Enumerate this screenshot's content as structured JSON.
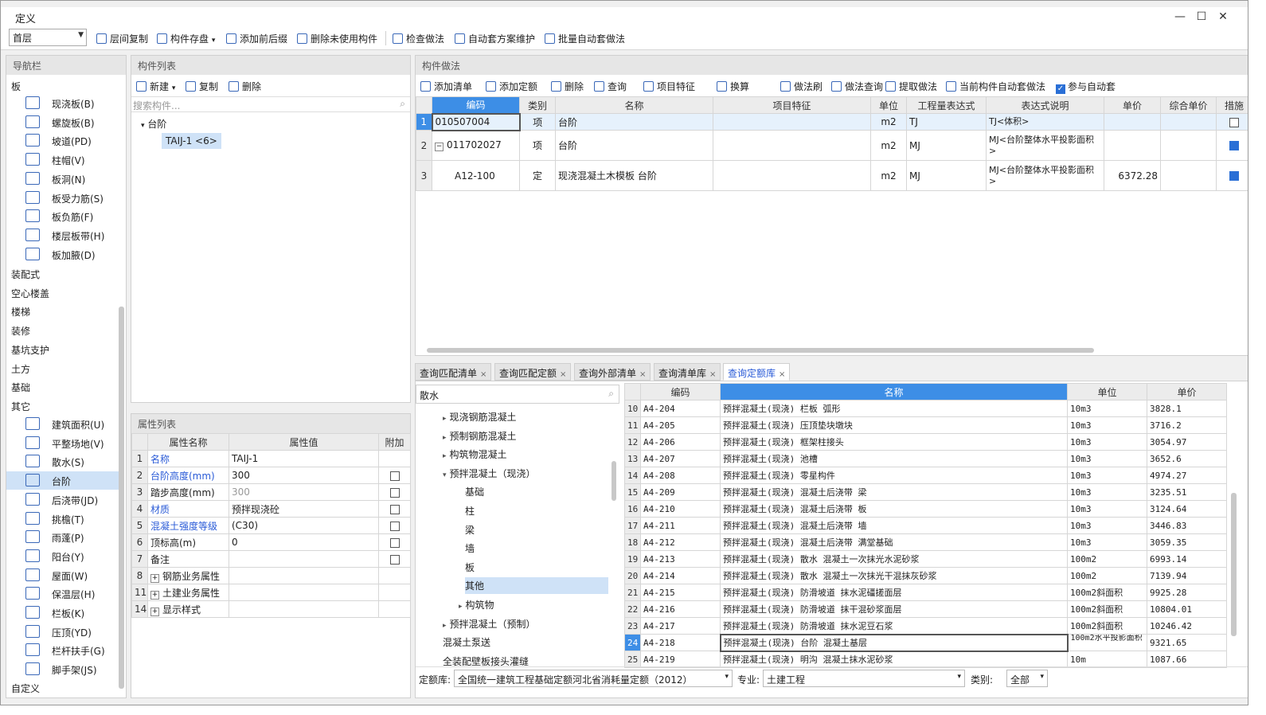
{
  "window": {
    "title": "定义"
  },
  "toolbar": {
    "floor_select": "首层",
    "items": [
      "层间复制",
      "构件存盘",
      "添加前后缀",
      "删除未使用构件",
      "检查做法",
      "自动套方案维护",
      "批量自动套做法"
    ]
  },
  "nav": {
    "header": "导航栏",
    "categories_top": [
      "板"
    ],
    "board_items": [
      "现浇板(B)",
      "螺旋板(B)",
      "坡道(PD)",
      "柱帽(V)",
      "板洞(N)",
      "板受力筋(S)",
      "板负筋(F)",
      "楼层板带(H)",
      "板加腋(D)"
    ],
    "categories_mid": [
      "装配式",
      "空心楼盖",
      "楼梯",
      "装修",
      "基坑支护",
      "土方",
      "基础",
      "其它"
    ],
    "other_items": [
      "建筑面积(U)",
      "平整场地(V)",
      "散水(S)",
      "台阶",
      "后浇带(JD)",
      "挑檐(T)",
      "雨蓬(P)",
      "阳台(Y)",
      "屋面(W)",
      "保温层(H)",
      "栏板(K)",
      "压顶(YD)",
      "栏杆扶手(G)",
      "脚手架(JS)"
    ],
    "selected": "台阶",
    "category_bottom": "自定义"
  },
  "component_list": {
    "header": "构件列表",
    "new_label": "新建",
    "copy_label": "复制",
    "delete_label": "删除",
    "search_placeholder": "搜索构件...",
    "tree_parent": "台阶",
    "tree_child": "TAIJ-1 <6>"
  },
  "properties": {
    "header": "属性列表",
    "columns": [
      "属性名称",
      "属性值",
      "附加"
    ],
    "rows": [
      {
        "n": "1",
        "name": "名称",
        "value": "TAIJ-1",
        "blue": true,
        "cb": false
      },
      {
        "n": "2",
        "name": "台阶高度(mm)",
        "value": "300",
        "blue": true,
        "cb": true
      },
      {
        "n": "3",
        "name": "踏步高度(mm)",
        "value": "300",
        "blue": false,
        "cb": true,
        "gray": true
      },
      {
        "n": "4",
        "name": "材质",
        "value": "预拌现浇砼",
        "blue": true,
        "cb": true
      },
      {
        "n": "5",
        "name": "混凝土强度等级",
        "value": "(C30)",
        "blue": true,
        "cb": true
      },
      {
        "n": "6",
        "name": "顶标高(m)",
        "value": "0",
        "blue": false,
        "cb": true
      },
      {
        "n": "7",
        "name": "备注",
        "value": "",
        "blue": false,
        "cb": true
      },
      {
        "n": "8",
        "name": "钢筋业务属性",
        "value": "",
        "expand": true
      },
      {
        "n": "11",
        "name": "土建业务属性",
        "value": "",
        "expand": true
      },
      {
        "n": "14",
        "name": "显示样式",
        "value": "",
        "expand": true
      }
    ]
  },
  "method": {
    "header": "构件做法",
    "toolbar": [
      "添加清单",
      "添加定额",
      "删除",
      "查询",
      "项目特征",
      "换算",
      "做法刷",
      "做法查询",
      "提取做法",
      "当前构件自动套做法",
      "参与自动套"
    ],
    "columns": [
      "编码",
      "类别",
      "名称",
      "项目特征",
      "单位",
      "工程量表达式",
      "表达式说明",
      "单价",
      "综合单价",
      "措施"
    ],
    "rows": [
      {
        "n": "1",
        "code": "010507004",
        "type": "项",
        "name": "台阶",
        "feature": "",
        "unit": "m2",
        "expr": "TJ",
        "desc": "TJ<体积>",
        "price": "",
        "cprice": ""
      },
      {
        "n": "2",
        "code": "011702027",
        "type": "项",
        "name": "台阶",
        "feature": "",
        "unit": "m2",
        "expr": "MJ",
        "desc": "MJ<台阶整体水平投影面积>",
        "price": "",
        "cprice": ""
      },
      {
        "n": "3",
        "code": "A12-100",
        "type": "定",
        "name": "现浇混凝土木模板 台阶",
        "feature": "",
        "unit": "m2",
        "expr": "MJ",
        "desc": "MJ<台阶整体水平投影面积>",
        "price": "6372.28",
        "cprice": ""
      }
    ]
  },
  "query_tabs": [
    "查询匹配清单",
    "查询匹配定额",
    "查询外部清单",
    "查询清单库",
    "查询定额库"
  ],
  "query": {
    "search_value": "散水",
    "tree": [
      {
        "label": "现浇钢筋混凝土",
        "level": 1,
        "arrow": "▸"
      },
      {
        "label": "预制钢筋混凝土",
        "level": 1,
        "arrow": "▸"
      },
      {
        "label": "构筑物混凝土",
        "level": 1,
        "arrow": "▸"
      },
      {
        "label": "预拌混凝土（现浇）",
        "level": 1,
        "arrow": "▾"
      },
      {
        "label": "基础",
        "level": 2,
        "arrow": ""
      },
      {
        "label": "柱",
        "level": 2,
        "arrow": ""
      },
      {
        "label": "梁",
        "level": 2,
        "arrow": ""
      },
      {
        "label": "墙",
        "level": 2,
        "arrow": ""
      },
      {
        "label": "板",
        "level": 2,
        "arrow": ""
      },
      {
        "label": "其他",
        "level": 2,
        "arrow": "",
        "sel": true
      },
      {
        "label": "构筑物",
        "level": 2,
        "arrow": "▸"
      },
      {
        "label": "预拌混凝土（预制）",
        "level": 1,
        "arrow": "▸"
      },
      {
        "label": "混凝土泵送",
        "level": 1,
        "arrow": ""
      },
      {
        "label": "全装配壁板接头灌缝",
        "level": 1,
        "arrow": ""
      }
    ],
    "columns": [
      "编码",
      "名称",
      "单位",
      "单价"
    ],
    "rows": [
      {
        "n": "10",
        "code": "A4-204",
        "name": "预拌混凝土(现浇) 栏板 弧形",
        "unit": "10m3",
        "price": "3828.1"
      },
      {
        "n": "11",
        "code": "A4-205",
        "name": "预拌混凝土(现浇) 压顶垫块墩块",
        "unit": "10m3",
        "price": "3716.2"
      },
      {
        "n": "12",
        "code": "A4-206",
        "name": "预拌混凝土(现浇) 框架柱接头",
        "unit": "10m3",
        "price": "3054.97"
      },
      {
        "n": "13",
        "code": "A4-207",
        "name": "预拌混凝土(现浇) 池槽",
        "unit": "10m3",
        "price": "3652.6"
      },
      {
        "n": "14",
        "code": "A4-208",
        "name": "预拌混凝土(现浇) 零星构件",
        "unit": "10m3",
        "price": "4974.27"
      },
      {
        "n": "15",
        "code": "A4-209",
        "name": "预拌混凝土(现浇) 混凝土后浇带 梁",
        "unit": "10m3",
        "price": "3235.51"
      },
      {
        "n": "16",
        "code": "A4-210",
        "name": "预拌混凝土(现浇) 混凝土后浇带 板",
        "unit": "10m3",
        "price": "3124.64"
      },
      {
        "n": "17",
        "code": "A4-211",
        "name": "预拌混凝土(现浇) 混凝土后浇带 墙",
        "unit": "10m3",
        "price": "3446.83"
      },
      {
        "n": "18",
        "code": "A4-212",
        "name": "预拌混凝土(现浇) 混凝土后浇带 满堂基础",
        "unit": "10m3",
        "price": "3059.35"
      },
      {
        "n": "19",
        "code": "A4-213",
        "name": "预拌混凝土(现浇) 散水 混凝土一次抹光水泥砂浆",
        "unit": "100m2",
        "price": "6993.14"
      },
      {
        "n": "20",
        "code": "A4-214",
        "name": "预拌混凝土(现浇) 散水 混凝土一次抹光干混抹灰砂浆",
        "unit": "100m2",
        "price": "7139.94"
      },
      {
        "n": "21",
        "code": "A4-215",
        "name": "预拌混凝土(现浇) 防滑坡道 抹水泥礓搓面层",
        "unit": "100m2斜面积",
        "price": "9925.28"
      },
      {
        "n": "22",
        "code": "A4-216",
        "name": "预拌混凝土(现浇) 防滑坡道 抹干混砂浆面层",
        "unit": "100m2斜面积",
        "price": "10804.01"
      },
      {
        "n": "23",
        "code": "A4-217",
        "name": "预拌混凝土(现浇) 防滑坡道 抹水泥豆石浆",
        "unit": "100m2斜面积",
        "price": "10246.42"
      },
      {
        "n": "24",
        "code": "A4-218",
        "name": "预拌混凝土(现浇) 台阶 混凝土基层",
        "unit": "100m2水平投影面积",
        "price": "9321.65",
        "sel": true
      },
      {
        "n": "25",
        "code": "A4-219",
        "name": "预拌混凝土(现浇) 明沟 混凝土抹水泥砂浆",
        "unit": "10m",
        "price": "1087.66"
      }
    ],
    "footer": {
      "lib_label": "定额库:",
      "lib_value": "全国统一建筑工程基础定额河北省消耗量定额（2012）",
      "spec_label": "专业:",
      "spec_value": "土建工程",
      "cat_label": "类别:",
      "cat_value": "全部"
    }
  }
}
